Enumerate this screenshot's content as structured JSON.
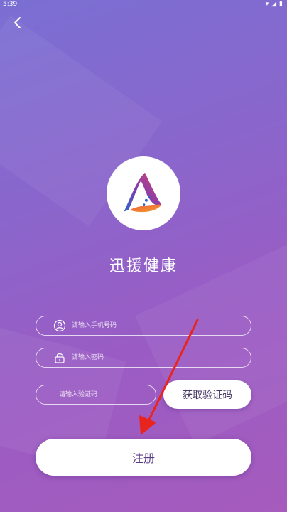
{
  "status": {
    "time": "5:39"
  },
  "app": {
    "name": "迅援健康"
  },
  "form": {
    "phone_placeholder": "请输入手机号码",
    "password_placeholder": "请输入密码",
    "code_placeholder": "请输入验证码",
    "get_code_label": "获取验证码",
    "register_label": "注册"
  },
  "icons": {
    "back": "chevron-left-icon",
    "user": "user-icon",
    "lock": "lock-icon",
    "logo": "app-logo",
    "arrow": "arrow-annotation"
  },
  "colors": {
    "gradient_start": "#7a6fd3",
    "gradient_end": "#a65bbd",
    "annotation_arrow": "#e8241c"
  }
}
